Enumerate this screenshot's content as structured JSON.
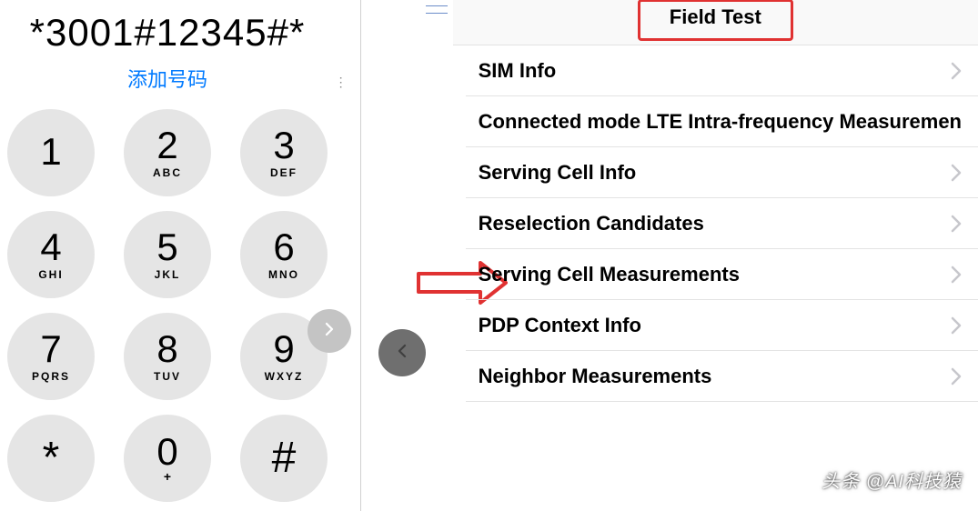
{
  "dialer": {
    "entered_number": "*3001#12345#*",
    "add_contact_label": "添加号码",
    "keys": [
      {
        "digit": "1",
        "letters": ""
      },
      {
        "digit": "2",
        "letters": "ABC"
      },
      {
        "digit": "3",
        "letters": "DEF"
      },
      {
        "digit": "4",
        "letters": "GHI"
      },
      {
        "digit": "5",
        "letters": "JKL"
      },
      {
        "digit": "6",
        "letters": "MNO"
      },
      {
        "digit": "7",
        "letters": "PQRS"
      },
      {
        "digit": "8",
        "letters": "TUV"
      },
      {
        "digit": "9",
        "letters": "WXYZ"
      },
      {
        "digit": "*",
        "letters": ""
      },
      {
        "digit": "0",
        "letters": "+"
      },
      {
        "digit": "#",
        "letters": ""
      }
    ]
  },
  "field_test": {
    "title": "Field Test",
    "rows": [
      {
        "label": "SIM Info",
        "chevron": true
      },
      {
        "label": "Connected mode LTE Intra-frequency Measuremen",
        "chevron": false
      },
      {
        "label": "Serving Cell Info",
        "chevron": true
      },
      {
        "label": "Reselection Candidates",
        "chevron": true
      },
      {
        "label": "Serving Cell Measurements",
        "chevron": true
      },
      {
        "label": "PDP Context Info",
        "chevron": true
      },
      {
        "label": "Neighbor Measurements",
        "chevron": true
      }
    ]
  },
  "watermark": "头条 @AI科技猿",
  "colors": {
    "accent_link": "#007aff",
    "highlight_red": "#e03232",
    "key_bg": "#e5e5e5"
  }
}
